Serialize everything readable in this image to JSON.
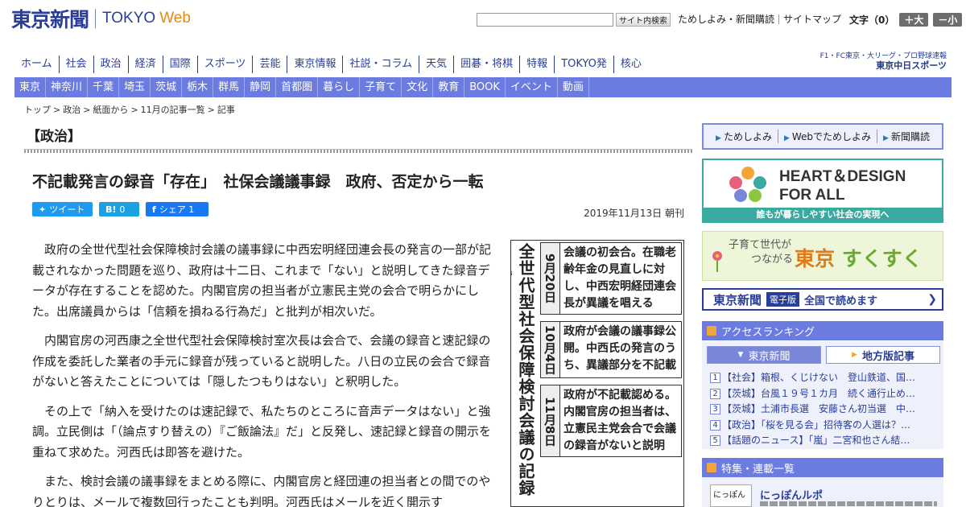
{
  "header": {
    "logo_jp": "東京新聞",
    "logo_en": "TOKYO",
    "logo_web": "Web",
    "search_button": "サイト内検索",
    "links": [
      "ためしよみ・新聞購読",
      "サイトマップ"
    ],
    "font_size_label": "文字（0）",
    "font_larger": "＋大",
    "font_smaller": "－小"
  },
  "main_nav": [
    "ホーム",
    "社会",
    "政治",
    "経済",
    "国際",
    "スポーツ",
    "芸能",
    "東京情報",
    "社説・コラム",
    "天気",
    "囲碁・将棋",
    "特報",
    "TOKYO発",
    "核心"
  ],
  "chunichi": {
    "line1": "F1・FC東京・大リーグ・プロ野球速報",
    "line2": "東京中日スポーツ"
  },
  "sub_nav": [
    "東京",
    "神奈川",
    "千葉",
    "埼玉",
    "茨城",
    "栃木",
    "群馬",
    "静岡",
    "首都圏",
    "暮らし",
    "子育て",
    "文化",
    "教育",
    "BOOK",
    "イベント",
    "動画"
  ],
  "breadcrumb": [
    "トップ",
    "政治",
    "紙面から",
    "11月の記事一覧",
    "記事"
  ],
  "article": {
    "section": "【政治】",
    "headline": "不記載発言の録音「存在」　社保会議議事録　政府、否定から一転",
    "share": {
      "tweet": "ツイート",
      "hatena_icon": "B!",
      "hatena_count": "0",
      "facebook": "シェア",
      "facebook_count": "1"
    },
    "date": "2019年11月13日 朝刊",
    "paragraphs": [
      "政府の全世代型社会保障検討会議の議事録に中西宏明経団連会長の発言の一部が記載されなかった問題を巡り、政府は十二日、これまで「ない」と説明してきた録音データが存在することを認めた。内閣官房の担当者が立憲民主党の会合で明らかにした。出席議員からは「信頼を損ねる行為だ」と批判が相次いだ。",
      "内閣官房の河西康之全世代型社会保障検討室次長は会合で、会議の録音と速記録の作成を委託した業者の手元に録音が残っていると説明した。八日の立民の会合で録音がないと答えたことについては「隠したつもりはない」と釈明した。",
      "その上で「納入を受けたのは速記録で、私たちのところに音声データはない」と強調。立民側は「（論点すり替えの）『ご飯論法』だ」と反発し、速記録と録音の開示を重ねて求めた。河西氏は即答を避けた。",
      "また、検討会議の議事録をまとめる際に、内閣官房と経団連の担当者との間でのやりとりは、メールで複数回行ったことも判明。河西氏はメールを近く開示す"
    ]
  },
  "graphic": {
    "title": "全世代型社会保障検討会議の記録を巡",
    "rows": [
      {
        "date": "9月20日",
        "text": "会議の初会合。在職老齢年金の見直しに対し、中西宏明経団連会長が異議を唱える"
      },
      {
        "date": "10月4日",
        "text": "政府が会議の議事録公開。中西氏の発言のうち、異議部分を不記載"
      },
      {
        "date": "11月8日",
        "text": "政府が不記載認める。内閣官房の担当者は、立憲民主党会合で会議の録音がないと説明"
      }
    ]
  },
  "sidebar": {
    "promo_links": [
      "ためしよみ",
      "Webでためしよみ",
      "新聞購読"
    ],
    "hd_line1": "HEART＆DESIGN",
    "hd_line2": "FOR ALL",
    "hd_foot": "誰もが暮らしやすい社会の実現へ",
    "suku_small1": "子育て世代が",
    "suku_small2": "つながる",
    "suku_big1": "東京",
    "suku_big2": "すくすく",
    "epaper_logo": "東京新聞",
    "epaper_tag": "電子版",
    "epaper_text": "全国で読めます",
    "ranking_title": "アクセスランキング",
    "ranking_tabs": [
      "東京新聞",
      "地方版記事"
    ],
    "ranking": [
      "【社会】箱根、くじけない　登山鉄道、国…",
      "【茨城】台風１９号１カ月　続く通行止め…",
      "【茨城】土浦市長選　安藤さん初当選　中…",
      "【政治】「桜を見る会」招待客の人選は？…",
      "【話題のニュース】「嵐」二宮和也さん結…"
    ],
    "feature_title": "特集・連載一覧",
    "feature_img": "にっぽん",
    "feature_item": "にっぽんルポ"
  },
  "colors": {
    "brand": "#2a3e97",
    "nav_bg": "#6b7be0",
    "accent": "#e08a16",
    "hd_green": "#3aa99f"
  }
}
